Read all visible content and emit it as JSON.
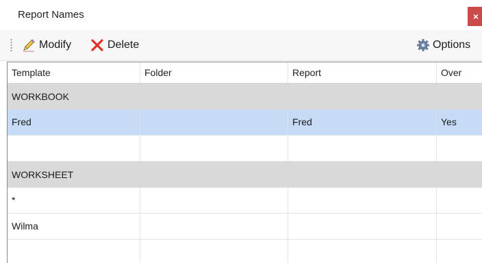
{
  "window": {
    "title": "Report Names",
    "close_label": "×"
  },
  "toolbar": {
    "modify_label": "Modify",
    "delete_label": "Delete",
    "options_label": "Options"
  },
  "grid": {
    "columns": [
      "Template",
      "Folder",
      "Report",
      "Over"
    ],
    "groups": [
      {
        "name": "WORKBOOK",
        "rows": [
          {
            "template": "Fred",
            "folder": "",
            "report": "Fred",
            "over": "Yes",
            "selected": true
          },
          {
            "template": "",
            "folder": "",
            "report": "",
            "over": "",
            "selected": false
          }
        ]
      },
      {
        "name": "WORKSHEET",
        "rows": [
          {
            "template": "*",
            "folder": "",
            "report": "",
            "over": "",
            "selected": false
          },
          {
            "template": "Wilma",
            "folder": "",
            "report": "",
            "over": "",
            "selected": false
          },
          {
            "template": "",
            "folder": "",
            "report": "",
            "over": "",
            "selected": false
          }
        ]
      }
    ]
  },
  "colors": {
    "selected_row": "#c6dcf6",
    "group_row": "#d9d9d9",
    "close_button": "#cc4a4a",
    "delete_icon": "#e0302a"
  },
  "icons": {
    "modify": "pencil-icon",
    "delete": "x-icon",
    "options": "gear-icon"
  }
}
